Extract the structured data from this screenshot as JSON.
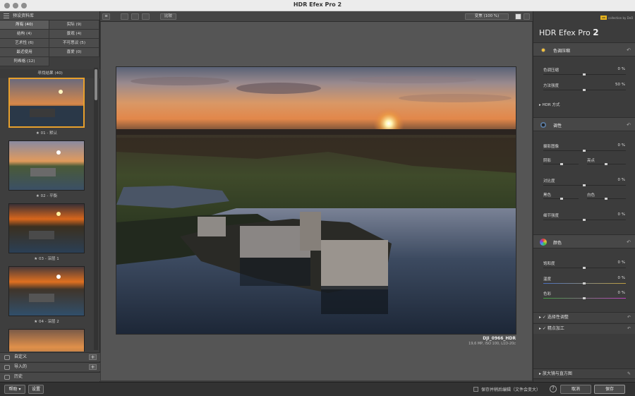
{
  "window": {
    "title": "HDR Efex Pro 2"
  },
  "left_panel": {
    "library_label": "预设资料库",
    "categories": [
      {
        "label": "所有 (40)",
        "selected": true
      },
      {
        "label": "实际 (9)"
      },
      {
        "label": "结构 (4)"
      },
      {
        "label": "景观 (4)"
      },
      {
        "label": "艺术性 (6)"
      },
      {
        "label": "不可思议 (5)"
      },
      {
        "label": "最近使用"
      },
      {
        "label": "喜爱 (0)"
      },
      {
        "label": "阿希格 (12)"
      }
    ],
    "presets_found": "寻找结果 (40)",
    "thumbnails": [
      {
        "caption": "★ 01 - 默认",
        "selected": true
      },
      {
        "caption": "★ 02 - 平衡"
      },
      {
        "caption": "★ 03 - 深层 1"
      },
      {
        "caption": "★ 04 - 深层 2"
      },
      {
        "caption": ""
      }
    ],
    "bottom_sections": [
      {
        "label": "自定义",
        "has_add": true
      },
      {
        "label": "导入的",
        "has_add": true
      },
      {
        "label": "历史",
        "has_add": false
      }
    ]
  },
  "toolbar": {
    "compare_label": "比较",
    "zoom_label": "变焦 (100 %)"
  },
  "image_meta": {
    "filename": "DJI_0966_HDR",
    "details": "19,6 MP, ISO 100, L1D-20c"
  },
  "right_panel": {
    "brand": "HDR Efex Pro",
    "brand_version": "2",
    "nik_logo": "nik",
    "nik_text": "collection by DxO",
    "sections": {
      "tone_compression": {
        "title": "色调压缩",
        "rows": [
          {
            "label": "色调压缩",
            "value": "0 %"
          },
          {
            "label": "方法强度",
            "value": "50 %"
          }
        ],
        "hdr_method": "HDR 方式"
      },
      "tone": {
        "title": "调性",
        "exposure": {
          "label": "摄影图像",
          "value": "0 %"
        },
        "shadows": "阴影",
        "highlights": "亮点",
        "contrast": {
          "label": "对比度",
          "value": "0 %"
        },
        "blacks": "黑色",
        "whites": "白色",
        "detail": {
          "label": "细节强度",
          "value": "0 %"
        }
      },
      "color": {
        "title": "颜色",
        "rows": [
          {
            "label": "饱和度",
            "value": "0 %"
          },
          {
            "label": "温度",
            "value": "0 %"
          },
          {
            "label": "色彩",
            "value": "0 %"
          }
        ]
      },
      "selective": "选择性调整",
      "finishing": "精点加工",
      "loupe": "放大镜与直方图"
    }
  },
  "bottom_bar": {
    "help_label": "帮助 ▾",
    "settings_label": "设置",
    "save_edit_label": "保存并稍后编辑（文件会变大）",
    "help_icon": "?",
    "cancel_label": "取消",
    "save_label": "保存"
  },
  "colors": {
    "accent": "#e8a02c"
  }
}
